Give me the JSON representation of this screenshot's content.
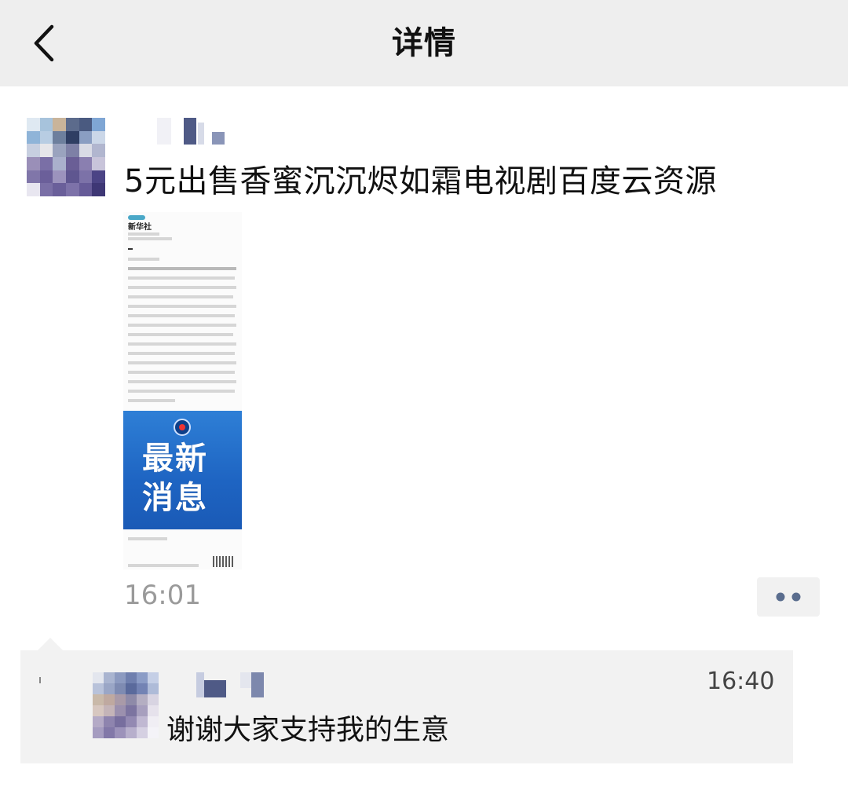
{
  "header": {
    "title": "详情",
    "back_icon": "chevron-left-icon"
  },
  "post": {
    "text": "5元出售香蜜沉沉烬如霜电视剧百度云资源",
    "time": "16:01",
    "more_icon": "two-dots-icon",
    "image": {
      "source_name": "新华社",
      "banner_text_line1": "最新",
      "banner_text_line2": "消息",
      "banner_color": "#1e64c2"
    }
  },
  "comment": {
    "text": "谢谢大家支持我的生意",
    "time": "16:40"
  },
  "colors": {
    "topbar_bg": "#eeeeee",
    "comment_bg": "#f2f2f2",
    "time_gray": "#9a9a9a",
    "more_dot": "#5a6d8e"
  }
}
